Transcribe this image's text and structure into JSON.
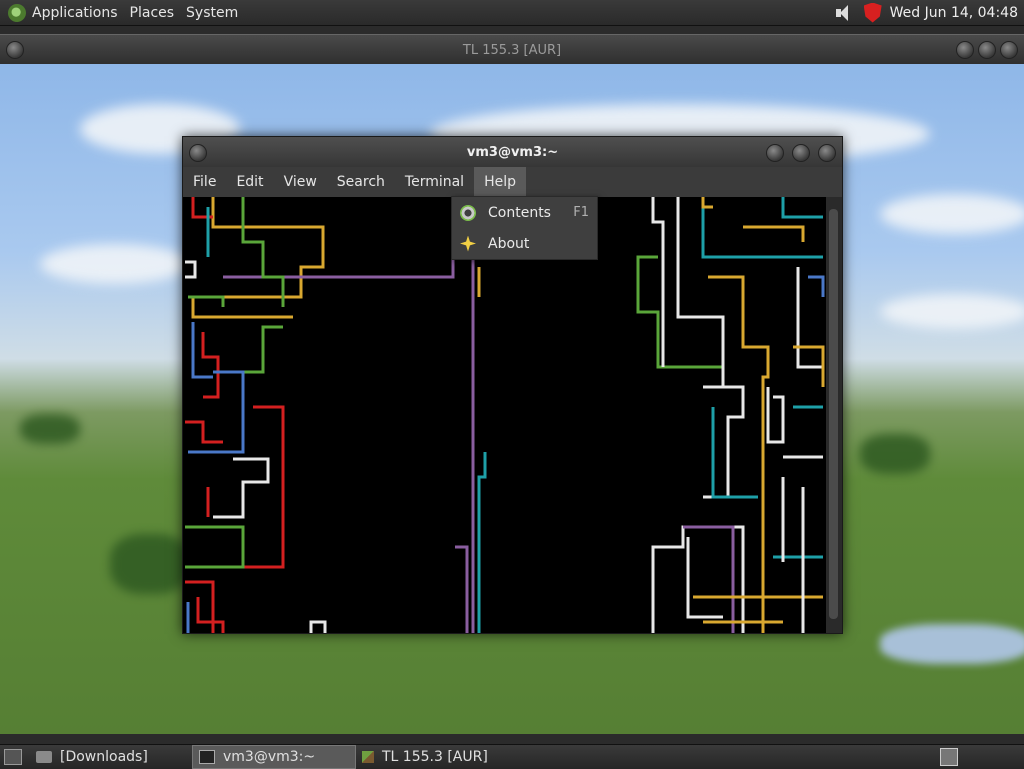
{
  "top_panel": {
    "menus": [
      "Applications",
      "Places",
      "System"
    ],
    "clock": "Wed Jun 14, 04:48"
  },
  "tl_window": {
    "title": "TL 155.3 [AUR]"
  },
  "terminal": {
    "title": "vm3@vm3:~",
    "menu": [
      "File",
      "Edit",
      "View",
      "Search",
      "Terminal",
      "Help"
    ],
    "active_menu": "Help",
    "help_items": [
      {
        "label": "Contents",
        "accel": "F1",
        "icon": "lifebuoy-icon"
      },
      {
        "label": "About",
        "accel": "",
        "icon": "star-icon"
      }
    ]
  },
  "taskbar": {
    "tasks": [
      {
        "label": "[Downloads]",
        "icon": "folder-icon"
      },
      {
        "label": "vm3@vm3:~",
        "icon": "terminal-icon",
        "active": true
      },
      {
        "label": "TL 155.3 [AUR]",
        "icon": "cube-icon"
      }
    ]
  },
  "colors": {
    "pipe_red": "#d42020",
    "pipe_green": "#5aa63a",
    "pipe_blue": "#4a78c8",
    "pipe_cyan": "#1ea0a8",
    "pipe_yellow": "#d9a830",
    "pipe_white": "#e8e8e8",
    "pipe_purple": "#8a5ea0"
  }
}
